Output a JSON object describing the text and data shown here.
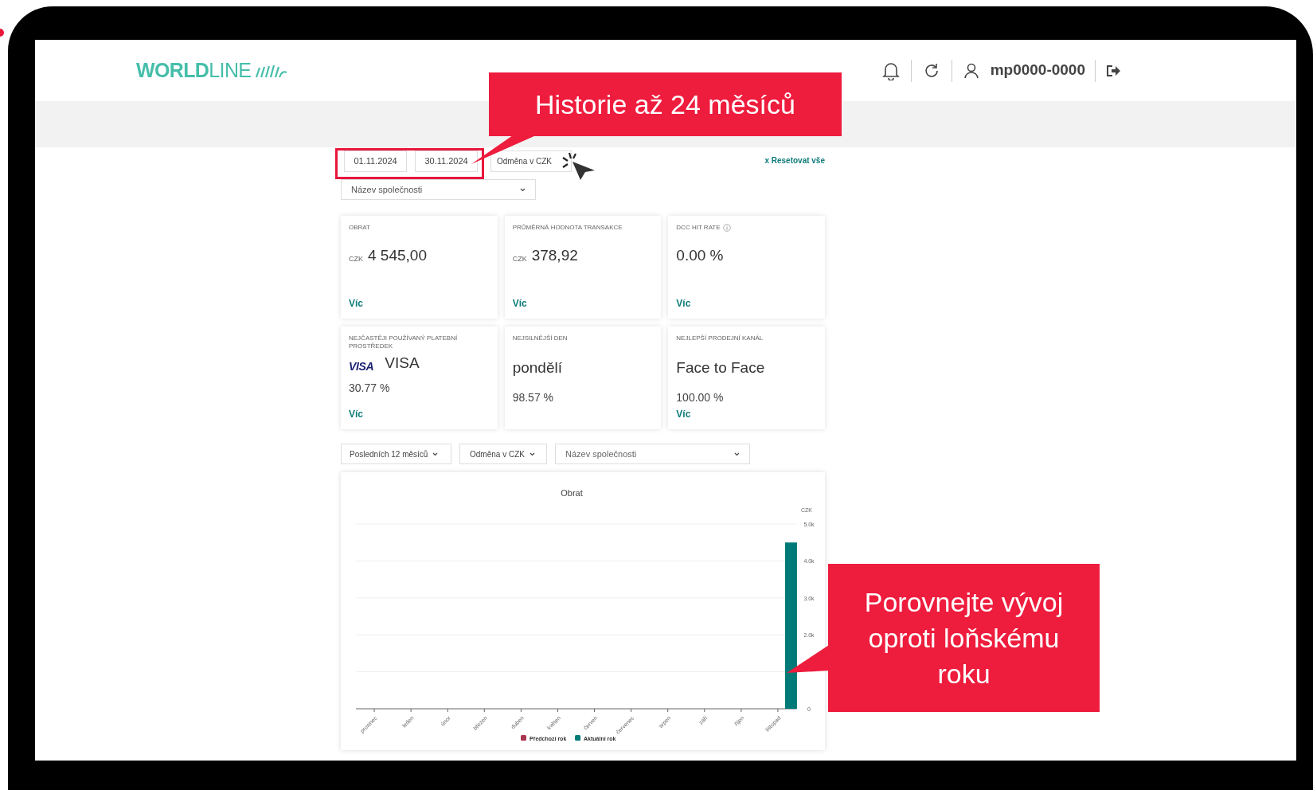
{
  "header": {
    "logo": "WORLDLINE",
    "username": "mp0000-0000"
  },
  "filters": {
    "date_from": "01.11.2024",
    "date_to": "30.11.2024",
    "currency": "Odměna v CZK",
    "company": "Název společnosti",
    "reset": "x Resetovat vše"
  },
  "cards": [
    {
      "kind": "amount",
      "title": "OBRAT",
      "currency": "CZK",
      "value": "4 545,00",
      "link": "Víc"
    },
    {
      "kind": "amount",
      "title": "PRŮMĚRNÁ HODNOTA TRANSAKCE",
      "currency": "CZK",
      "value": "378,92",
      "link": "Víc"
    },
    {
      "kind": "rate",
      "title": "DCC HIT RATE",
      "info": true,
      "value": "0.00 %",
      "link": "Víc"
    },
    {
      "kind": "brand",
      "title": "NEJČASTĚJI POUŽÍVANÝ PLATEBNÍ PROSTŘEDEK",
      "brand_logo": "VISA",
      "value": "VISA",
      "share": "30.77 %",
      "link": "Víc"
    },
    {
      "kind": "share",
      "title": "NEJSILNĚJŠÍ DEN",
      "value": "pondělí",
      "share": "98.57 %"
    },
    {
      "kind": "share",
      "title": "NEJLEPŠÍ PRODEJNÍ KANÁL",
      "value": "Face to Face",
      "share": "100.00 %",
      "link": "Víc"
    }
  ],
  "chart_filters": {
    "period": "Posledních 12 měsíců",
    "currency": "Odměna v CZK",
    "company": "Název společnosti"
  },
  "chart": {
    "unit": "CZK",
    "chart_data": {
      "type": "bar",
      "grid": true,
      "title": "Obrat",
      "categories": [
        "prosinec",
        "leden",
        "únor",
        "březen",
        "duben",
        "květen",
        "červen",
        "červenec",
        "srpen",
        "září",
        "říjen",
        "listopad"
      ],
      "series": [
        {
          "name": "Předchozí rok",
          "color": "#a8354f",
          "values": [
            null,
            null,
            null,
            null,
            null,
            null,
            null,
            null,
            null,
            null,
            null,
            null
          ]
        },
        {
          "name": "Aktuální rok",
          "color": "#007a78",
          "values": [
            null,
            null,
            null,
            null,
            null,
            null,
            null,
            null,
            null,
            null,
            null,
            4500
          ]
        }
      ],
      "ylim": [
        0,
        5000
      ],
      "yticks": [
        0,
        {
          "value": 2000,
          "label": "2.0k"
        },
        {
          "value": 3000,
          "label": "3.0k"
        },
        {
          "value": 4000,
          "label": "4.0k"
        },
        {
          "value": 5000,
          "label": "5.0k"
        }
      ]
    }
  },
  "callouts": [
    {
      "text": "Historie až 24 měsíců"
    },
    {
      "text": "Porovnejte vývoj oproti loňskému roku"
    }
  ]
}
